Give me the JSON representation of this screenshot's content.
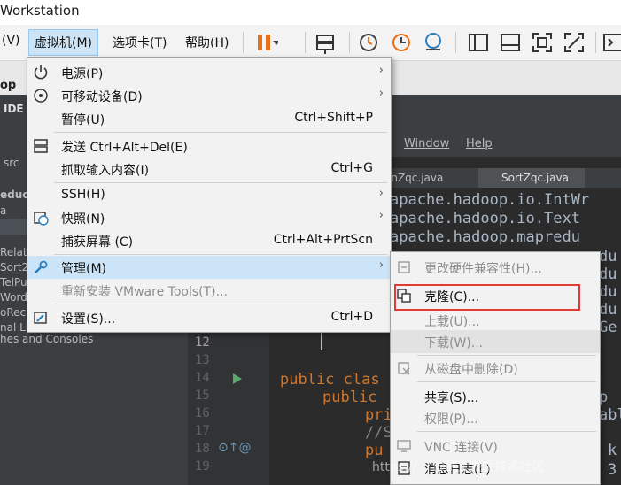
{
  "window_title": "Workstation",
  "menubar": {
    "items": [
      "(V)",
      "虚拟机(M)",
      "选项卡(T)",
      "帮助(H)"
    ]
  },
  "ide": {
    "tab": "op",
    "menu_items": [
      "Window",
      "Help"
    ],
    "left_items": [
      "src",
      "educ",
      "a",
      "Relat",
      "Sort2",
      "TelPu",
      "Word",
      "oRec",
      "nal Li",
      "hes and Consoles"
    ],
    "ide_label": "IDE",
    "file_tabs": [
      "onZqc.java",
      "SortZqc.java"
    ],
    "code_lines": [
      "apache.hadoop.io.IntWr",
      "apache.hadoop.io.Text",
      "apache.hadoop.mapredu"
    ],
    "line_numbers": [
      "12",
      "13",
      "14",
      "15",
      "16",
      "17",
      "18",
      "19"
    ],
    "code_partial": [
      "du",
      "du",
      "du",
      "du",
      "Ge",
      "p",
      "abl",
      "k",
      "3"
    ],
    "code_keywords": [
      "public clas",
      "public",
      "pri",
      "//S",
      "pu"
    ],
    "gutter_marks": "⊙↑@"
  },
  "vm_menu": {
    "items": [
      {
        "label": "电源(P)",
        "shortcut": "",
        "submenu": true,
        "icon": "power-icon"
      },
      {
        "label": "可移动设备(D)",
        "shortcut": "",
        "submenu": true,
        "icon": "disc-icon"
      },
      {
        "label": "暂停(U)",
        "shortcut": "Ctrl+Shift+P",
        "submenu": false,
        "icon": ""
      },
      {
        "label": "发送 Ctrl+Alt+Del(E)",
        "shortcut": "",
        "submenu": false,
        "icon": "keyboard-icon"
      },
      {
        "label": "抓取输入内容(I)",
        "shortcut": "Ctrl+G",
        "submenu": false,
        "icon": ""
      },
      {
        "label": "SSH(H)",
        "shortcut": "",
        "submenu": true,
        "icon": ""
      },
      {
        "label": "快照(N)",
        "shortcut": "",
        "submenu": true,
        "icon": "snapshot-icon"
      },
      {
        "label": "捕获屏幕 (C)",
        "shortcut": "Ctrl+Alt+PrtScn",
        "submenu": false,
        "icon": ""
      },
      {
        "label": "管理(M)",
        "shortcut": "",
        "submenu": true,
        "icon": "wrench-icon",
        "highlighted": true
      },
      {
        "label": "重新安装 VMware Tools(T)...",
        "shortcut": "",
        "submenu": false,
        "icon": "",
        "disabled": true
      },
      {
        "label": "设置(S)...",
        "shortcut": "Ctrl+D",
        "submenu": false,
        "icon": "settings-icon"
      }
    ]
  },
  "manage_submenu": {
    "items": [
      {
        "label": "更改硬件兼容性(H)...",
        "disabled": true,
        "icon": "hardware-icon"
      },
      {
        "label": "克隆(C)...",
        "disabled": false,
        "icon": "clone-icon",
        "boxed": true
      },
      {
        "label": "上载(U)...",
        "disabled": true,
        "icon": ""
      },
      {
        "label": "下载(W)...",
        "disabled": true,
        "icon": "",
        "hovered": true
      },
      {
        "label": "从磁盘中删除(D)",
        "disabled": true,
        "icon": "delete-icon"
      },
      {
        "label": "共享(S)...",
        "disabled": false,
        "icon": ""
      },
      {
        "label": "权限(P)...",
        "disabled": true,
        "icon": ""
      },
      {
        "label": "VNC 连接(V)",
        "disabled": true,
        "icon": "vnc-icon"
      },
      {
        "label": "消息日志(L)",
        "disabled": false,
        "icon": "log-icon"
      }
    ]
  },
  "watermark": "https://…  @稀土掘金技术社区",
  "colors": {
    "highlight": "#cce4f7",
    "red_box": "#e53935",
    "pause_orange": "#e8701a"
  }
}
